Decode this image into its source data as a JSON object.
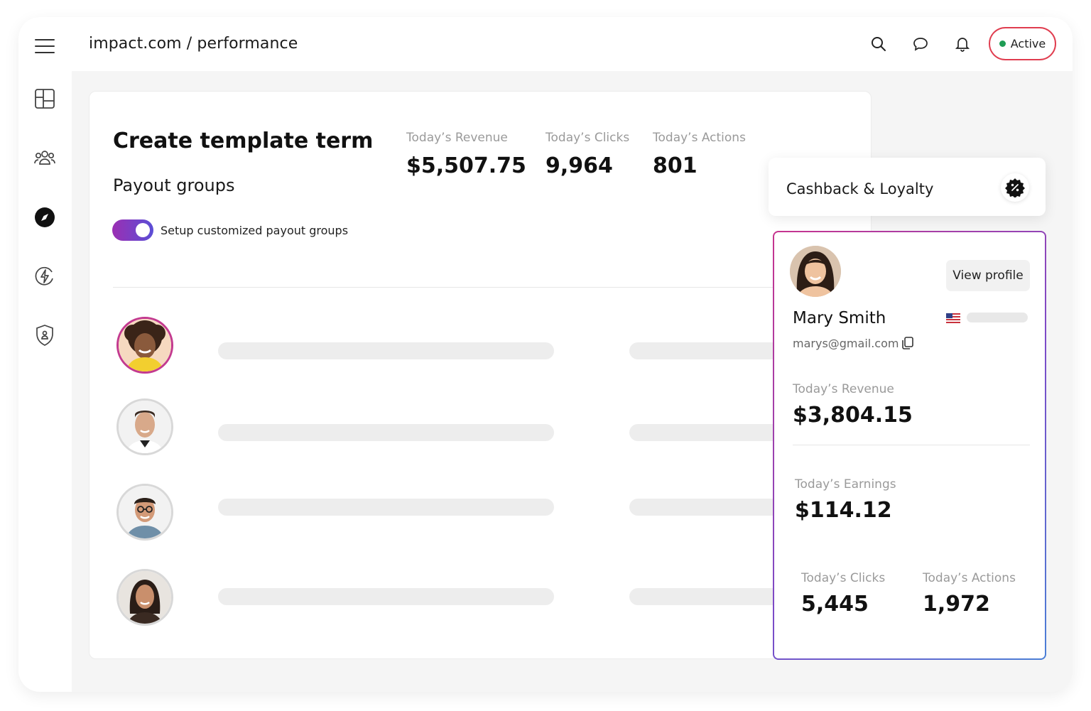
{
  "header": {
    "breadcrumb": "impact.com / performance",
    "status_label": "Active",
    "status_color": "#1f9d55",
    "icons": [
      "search-icon",
      "chat-icon",
      "bell-icon"
    ]
  },
  "sidebar": {
    "items": [
      {
        "name": "menu-icon"
      },
      {
        "name": "dashboard-icon"
      },
      {
        "name": "users-icon"
      },
      {
        "name": "compass-icon",
        "active": true
      },
      {
        "name": "lightning-icon"
      },
      {
        "name": "shield-icon"
      }
    ]
  },
  "main": {
    "title": "Create template term",
    "section_title": "Payout groups",
    "toggle": {
      "label": "Setup customized payout groups",
      "on": true
    },
    "stats": [
      {
        "label": "Today’s Revenue",
        "value": "$5,507.75"
      },
      {
        "label": "Today’s Clicks",
        "value": "9,964"
      },
      {
        "label": "Today’s Actions",
        "value": "801"
      }
    ]
  },
  "cashback": {
    "title": "Cashback & Loyalty"
  },
  "profile": {
    "view_profile_label": "View profile",
    "name": "Mary Smith",
    "email": "marys@gmail.com",
    "revenue": {
      "label": "Today’s Revenue",
      "value": "$3,804.15"
    },
    "earnings": {
      "label": "Today’s Earnings",
      "value": "$114.12"
    },
    "clicks": {
      "label": "Today’s Clicks",
      "value": "5,445"
    },
    "actions": {
      "label": "Today’s Actions",
      "value": "1,972"
    }
  },
  "colors": {
    "accent_pink": "#c7348e",
    "accent_blue": "#4a7fd6",
    "status_border": "#e03d4f"
  }
}
